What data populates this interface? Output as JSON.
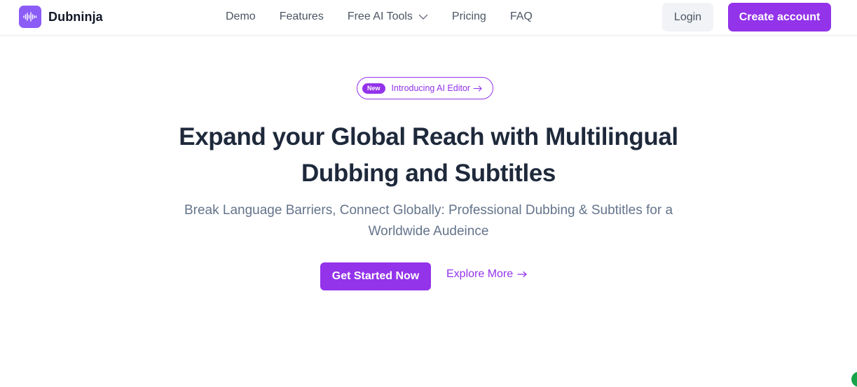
{
  "brand": {
    "name": "Dubninja",
    "logo_icon": "sound-wave-icon",
    "logo_color": "#8b5cf6"
  },
  "nav": {
    "items": [
      {
        "label": "Demo"
      },
      {
        "label": "Features"
      },
      {
        "label": "Free AI Tools",
        "has_dropdown": true,
        "icon": "chevron-down-icon"
      },
      {
        "label": "Pricing"
      },
      {
        "label": "FAQ"
      }
    ],
    "login_label": "Login",
    "create_label": "Create account"
  },
  "hero": {
    "badge": "New",
    "announcement": "Introducing AI Editor",
    "headline": "Expand your Global Reach with Multilingual Dubbing and Subtitles",
    "subheadline": "Break Language Barriers, Connect Globally: Professional Dubbing & Subtitles for a Worldwide Audeince",
    "primary_cta": "Get Started Now",
    "secondary_cta": "Explore More",
    "secondary_icon": "arrow-right-icon"
  },
  "colors": {
    "accent": "#9333ea",
    "heading": "#1e293b",
    "muted": "#64748b",
    "nav_text": "#4b5563",
    "login_bg": "#f1f3f6"
  }
}
